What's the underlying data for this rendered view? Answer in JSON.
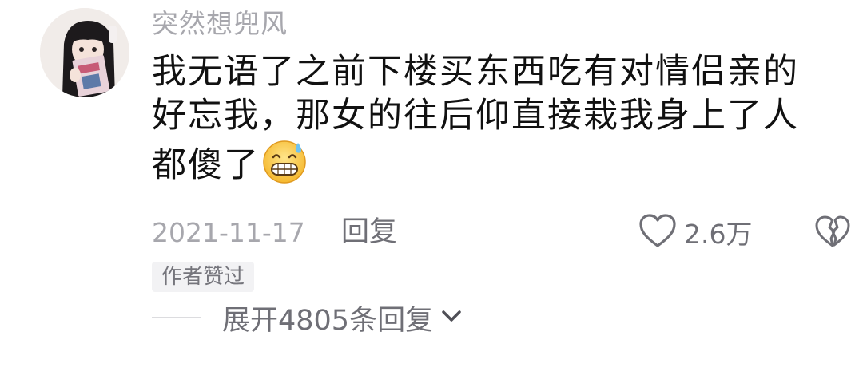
{
  "comment": {
    "username": "突然想兜风",
    "text_lines": [
      "我无语了之前下楼买东西吃有对情侣亲的",
      "好忘我，那女的往后仰直接栽我身上了人",
      "都傻了"
    ],
    "emoji": "sweat-grin-emoji",
    "date": "2021-11-17",
    "reply_label": "回复",
    "like_count": "2.6万",
    "author_badge": "作者赞过",
    "expand_label": "展开4805条回复"
  },
  "icons": {
    "like": "heart-outline-icon",
    "dislike": "broken-heart-icon",
    "expand": "chevron-down-icon"
  },
  "colors": {
    "username": "#a7a7ad",
    "text": "#111111",
    "meta": "#6f6f76",
    "badge_bg": "#f2f2f4"
  }
}
